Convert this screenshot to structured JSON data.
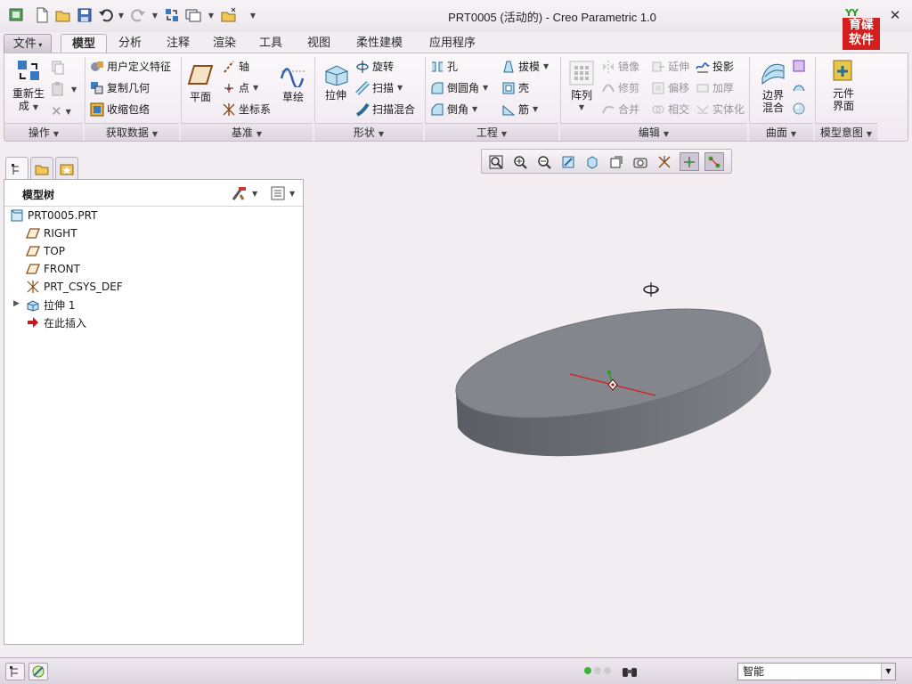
{
  "window": {
    "title": "PRT0005 (活动的) - Creo Parametric 1.0"
  },
  "logo": {
    "top": "YY",
    "line1": "育碟",
    "line2": "软件"
  },
  "help": {
    "glyph": "?"
  },
  "tabs": [
    {
      "label": "文件"
    },
    {
      "label": "模型"
    },
    {
      "label": "分析"
    },
    {
      "label": "注释"
    },
    {
      "label": "渲染"
    },
    {
      "label": "工具"
    },
    {
      "label": "视图"
    },
    {
      "label": "柔性建模"
    },
    {
      "label": "应用程序"
    }
  ],
  "ribbon": {
    "operations": {
      "regen_line1": "重新生",
      "regen_line2": "成",
      "group": "操作"
    },
    "get_data": {
      "udf": "用户定义特征",
      "copy_geom": "复制几何",
      "shrinkwrap": "收缩包络",
      "group": "获取数据"
    },
    "datum": {
      "plane": "平面",
      "axis": "轴",
      "point": "点",
      "csys": "坐标系",
      "sketch": "草绘",
      "group": "基准"
    },
    "shapes": {
      "extrude": "拉伸",
      "revolve": "旋转",
      "sweep": "扫描",
      "swept_blend": "扫描混合",
      "group": "形状"
    },
    "engineering": {
      "hole": "孔",
      "draft": "拔模",
      "round": "倒圆角",
      "shell": "壳",
      "chamfer": "倒角",
      "rib": "筋",
      "group": "工程"
    },
    "editing": {
      "pattern": "阵列",
      "mirror": "镜像",
      "extend": "延伸",
      "project": "投影",
      "trim": "修剪",
      "offset": "偏移",
      "thicken": "加厚",
      "merge": "合并",
      "intersect": "相交",
      "solidify": "实体化",
      "group": "编辑"
    },
    "surfaces": {
      "boundary_line1": "边界",
      "boundary_line2": "混合",
      "group": "曲面"
    },
    "model_intent": {
      "comp_line1": "元件",
      "comp_line2": "界面",
      "group": "模型意图"
    }
  },
  "model_tree": {
    "title": "模型树",
    "items": [
      {
        "label": "PRT0005.PRT",
        "icon": "part-icon"
      },
      {
        "label": "RIGHT",
        "icon": "datum-plane-icon"
      },
      {
        "label": "TOP",
        "icon": "datum-plane-icon"
      },
      {
        "label": "FRONT",
        "icon": "datum-plane-icon"
      },
      {
        "label": "PRT_CSYS_DEF",
        "icon": "csys-icon"
      },
      {
        "label": "拉伸 1",
        "icon": "extrude-icon"
      },
      {
        "label": "在此插入",
        "icon": "insert-here-arrow-icon"
      }
    ]
  },
  "statusbar": {
    "filter": "智能"
  },
  "colors": {
    "background": "#f1edf1",
    "model": "#7b7e86",
    "insert_arrow": "#c8171c"
  }
}
